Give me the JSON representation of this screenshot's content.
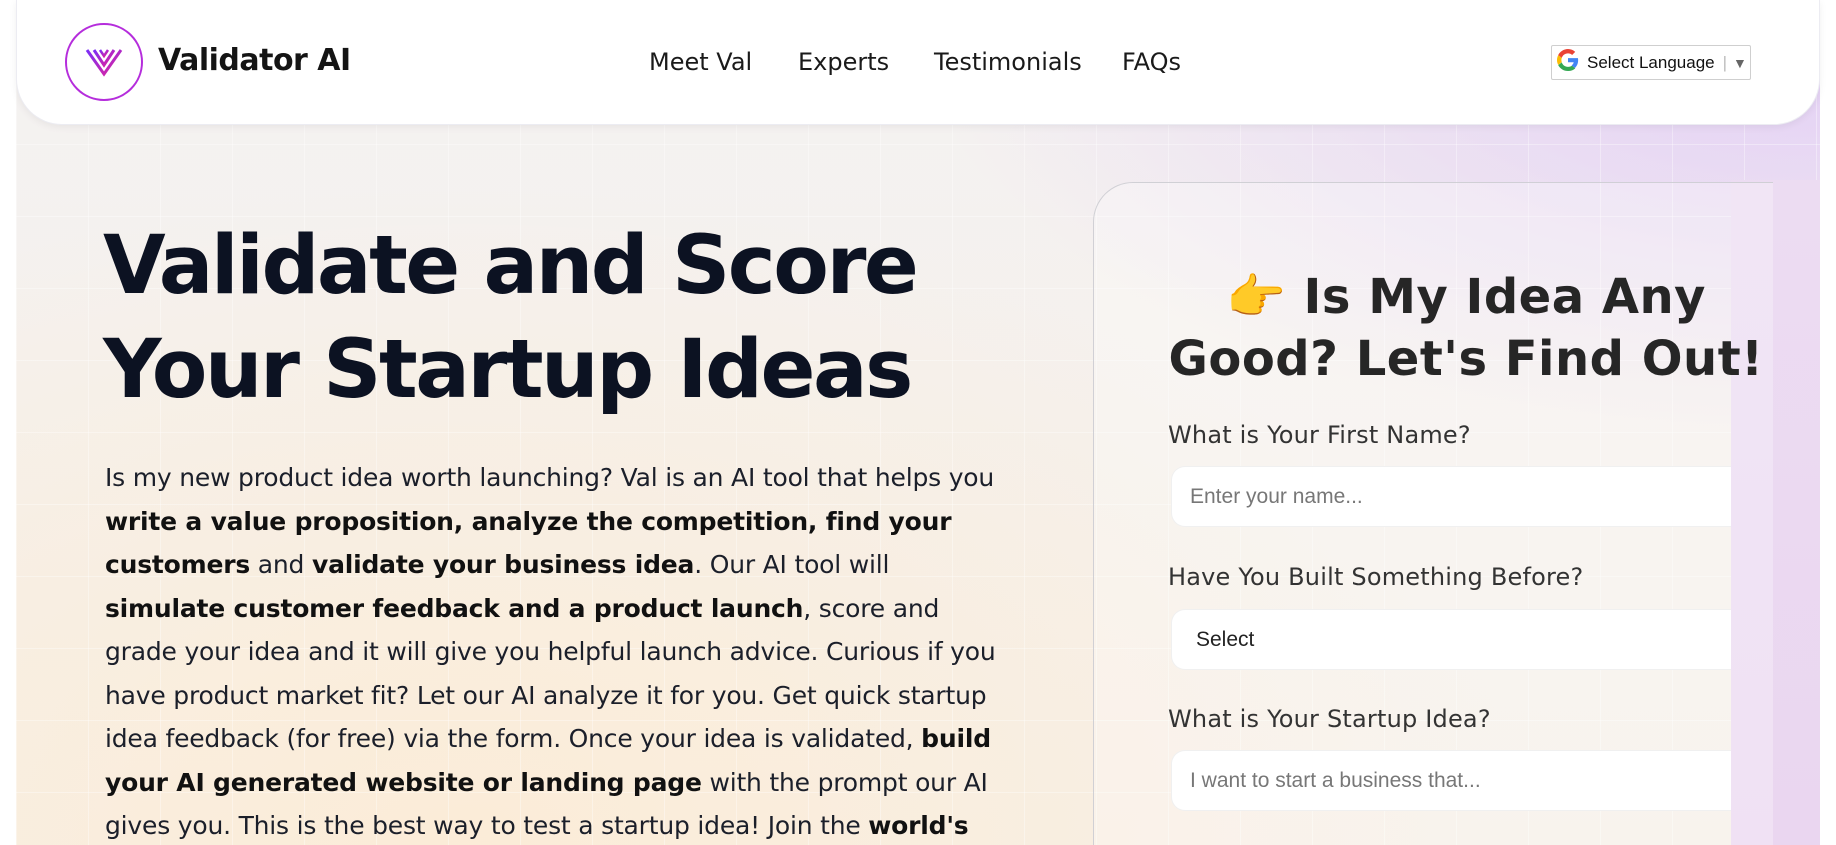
{
  "header": {
    "logo_text": "Validator AI",
    "nav": [
      "Meet Val",
      "Experts",
      "Testimonials",
      "FAQs"
    ],
    "language_select": "Select Language"
  },
  "hero": {
    "title_line1": "Validate and Score",
    "title_line2": "Your Startup Ideas",
    "body_segments": [
      {
        "t": "Is my new product idea worth launching?   Val is an AI tool that helps you ",
        "b": false
      },
      {
        "t": "write a value proposition, analyze the competition, find your customers",
        "b": true
      },
      {
        "t": " and ",
        "b": false
      },
      {
        "t": "validate your business idea",
        "b": true
      },
      {
        "t": ".  Our AI tool will ",
        "b": false
      },
      {
        "t": "simulate customer feedback and a product launch",
        "b": true
      },
      {
        "t": ", score and grade your idea and it will give you helpful launch advice.  Curious if you have product market fit?  Let our AI analyze it for you.  Get quick startup idea feedback (for free) via the form.  Once your idea is validated, ",
        "b": false
      },
      {
        "t": "build your AI generated website or landing page",
        "b": true
      },
      {
        "t": " with the prompt our AI gives you.  This is the best way to test a startup idea!  Join the ",
        "b": false
      },
      {
        "t": "world's",
        "b": true
      }
    ]
  },
  "form": {
    "emoji": "👉",
    "title_line1": "Is My Idea Any",
    "title_line2": "Good?  Let's Find Out!",
    "name_label": "What is Your First Name?",
    "name_placeholder": "Enter your name...",
    "built_label": "Have You Built Something Before?",
    "built_value": "Select",
    "idea_label": "What is Your Startup Idea?",
    "idea_placeholder": "I want to start a business that..."
  },
  "colors": {
    "logo_accent": "#b52ddc",
    "heading": "#0c1222"
  }
}
